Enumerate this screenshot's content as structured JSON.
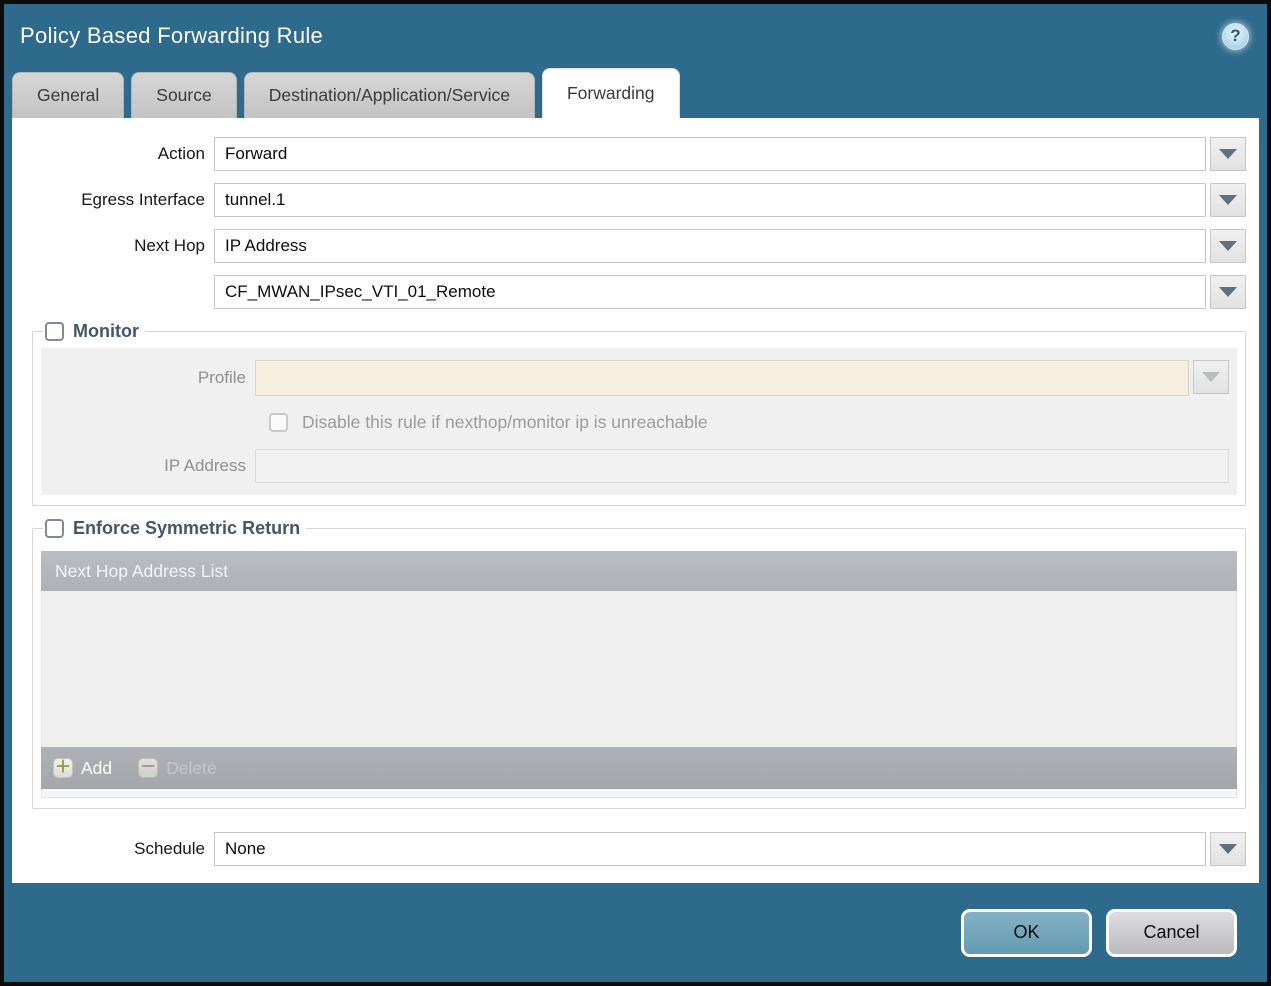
{
  "dialog": {
    "title": "Policy Based Forwarding Rule",
    "help_icon": "?"
  },
  "tabs": [
    {
      "label": "General",
      "active": false
    },
    {
      "label": "Source",
      "active": false
    },
    {
      "label": "Destination/Application/Service",
      "active": false
    },
    {
      "label": "Forwarding",
      "active": true
    }
  ],
  "form": {
    "action": {
      "label": "Action",
      "value": "Forward"
    },
    "egress_interface": {
      "label": "Egress Interface",
      "value": "tunnel.1"
    },
    "next_hop": {
      "label": "Next Hop",
      "value": "IP Address"
    },
    "next_hop_address": {
      "value": "CF_MWAN_IPsec_VTI_01_Remote"
    },
    "schedule": {
      "label": "Schedule",
      "value": "None"
    }
  },
  "monitor": {
    "label": "Monitor",
    "checked": false,
    "profile": {
      "label": "Profile",
      "value": ""
    },
    "disable_rule": {
      "label": "Disable this rule if nexthop/monitor ip is unreachable",
      "checked": false
    },
    "ip_address": {
      "label": "IP Address",
      "value": ""
    }
  },
  "enforce_symmetric_return": {
    "label": "Enforce Symmetric Return",
    "checked": false,
    "table": {
      "header": "Next Hop Address List",
      "rows": []
    },
    "add_label": "Add",
    "delete_label": "Delete"
  },
  "footer": {
    "ok_label": "OK",
    "cancel_label": "Cancel"
  },
  "colors": {
    "dialog_background": "#2e6a8b",
    "active_tab_background": "#ffffff",
    "inactive_tab_background": "#c9c9c9",
    "disabled_field_cream": "#f6efdd",
    "panel_gray": "#f0f0f0",
    "table_header_gray": "#b2b6ba",
    "table_footer_gray": "#a9adb1",
    "ok_button": "#6fa3ba",
    "cancel_button": "#c9c9cd",
    "legend_text": "#44566b",
    "add_plus_green": "#8c9a2e",
    "delete_minus_red": "#c9757d"
  }
}
